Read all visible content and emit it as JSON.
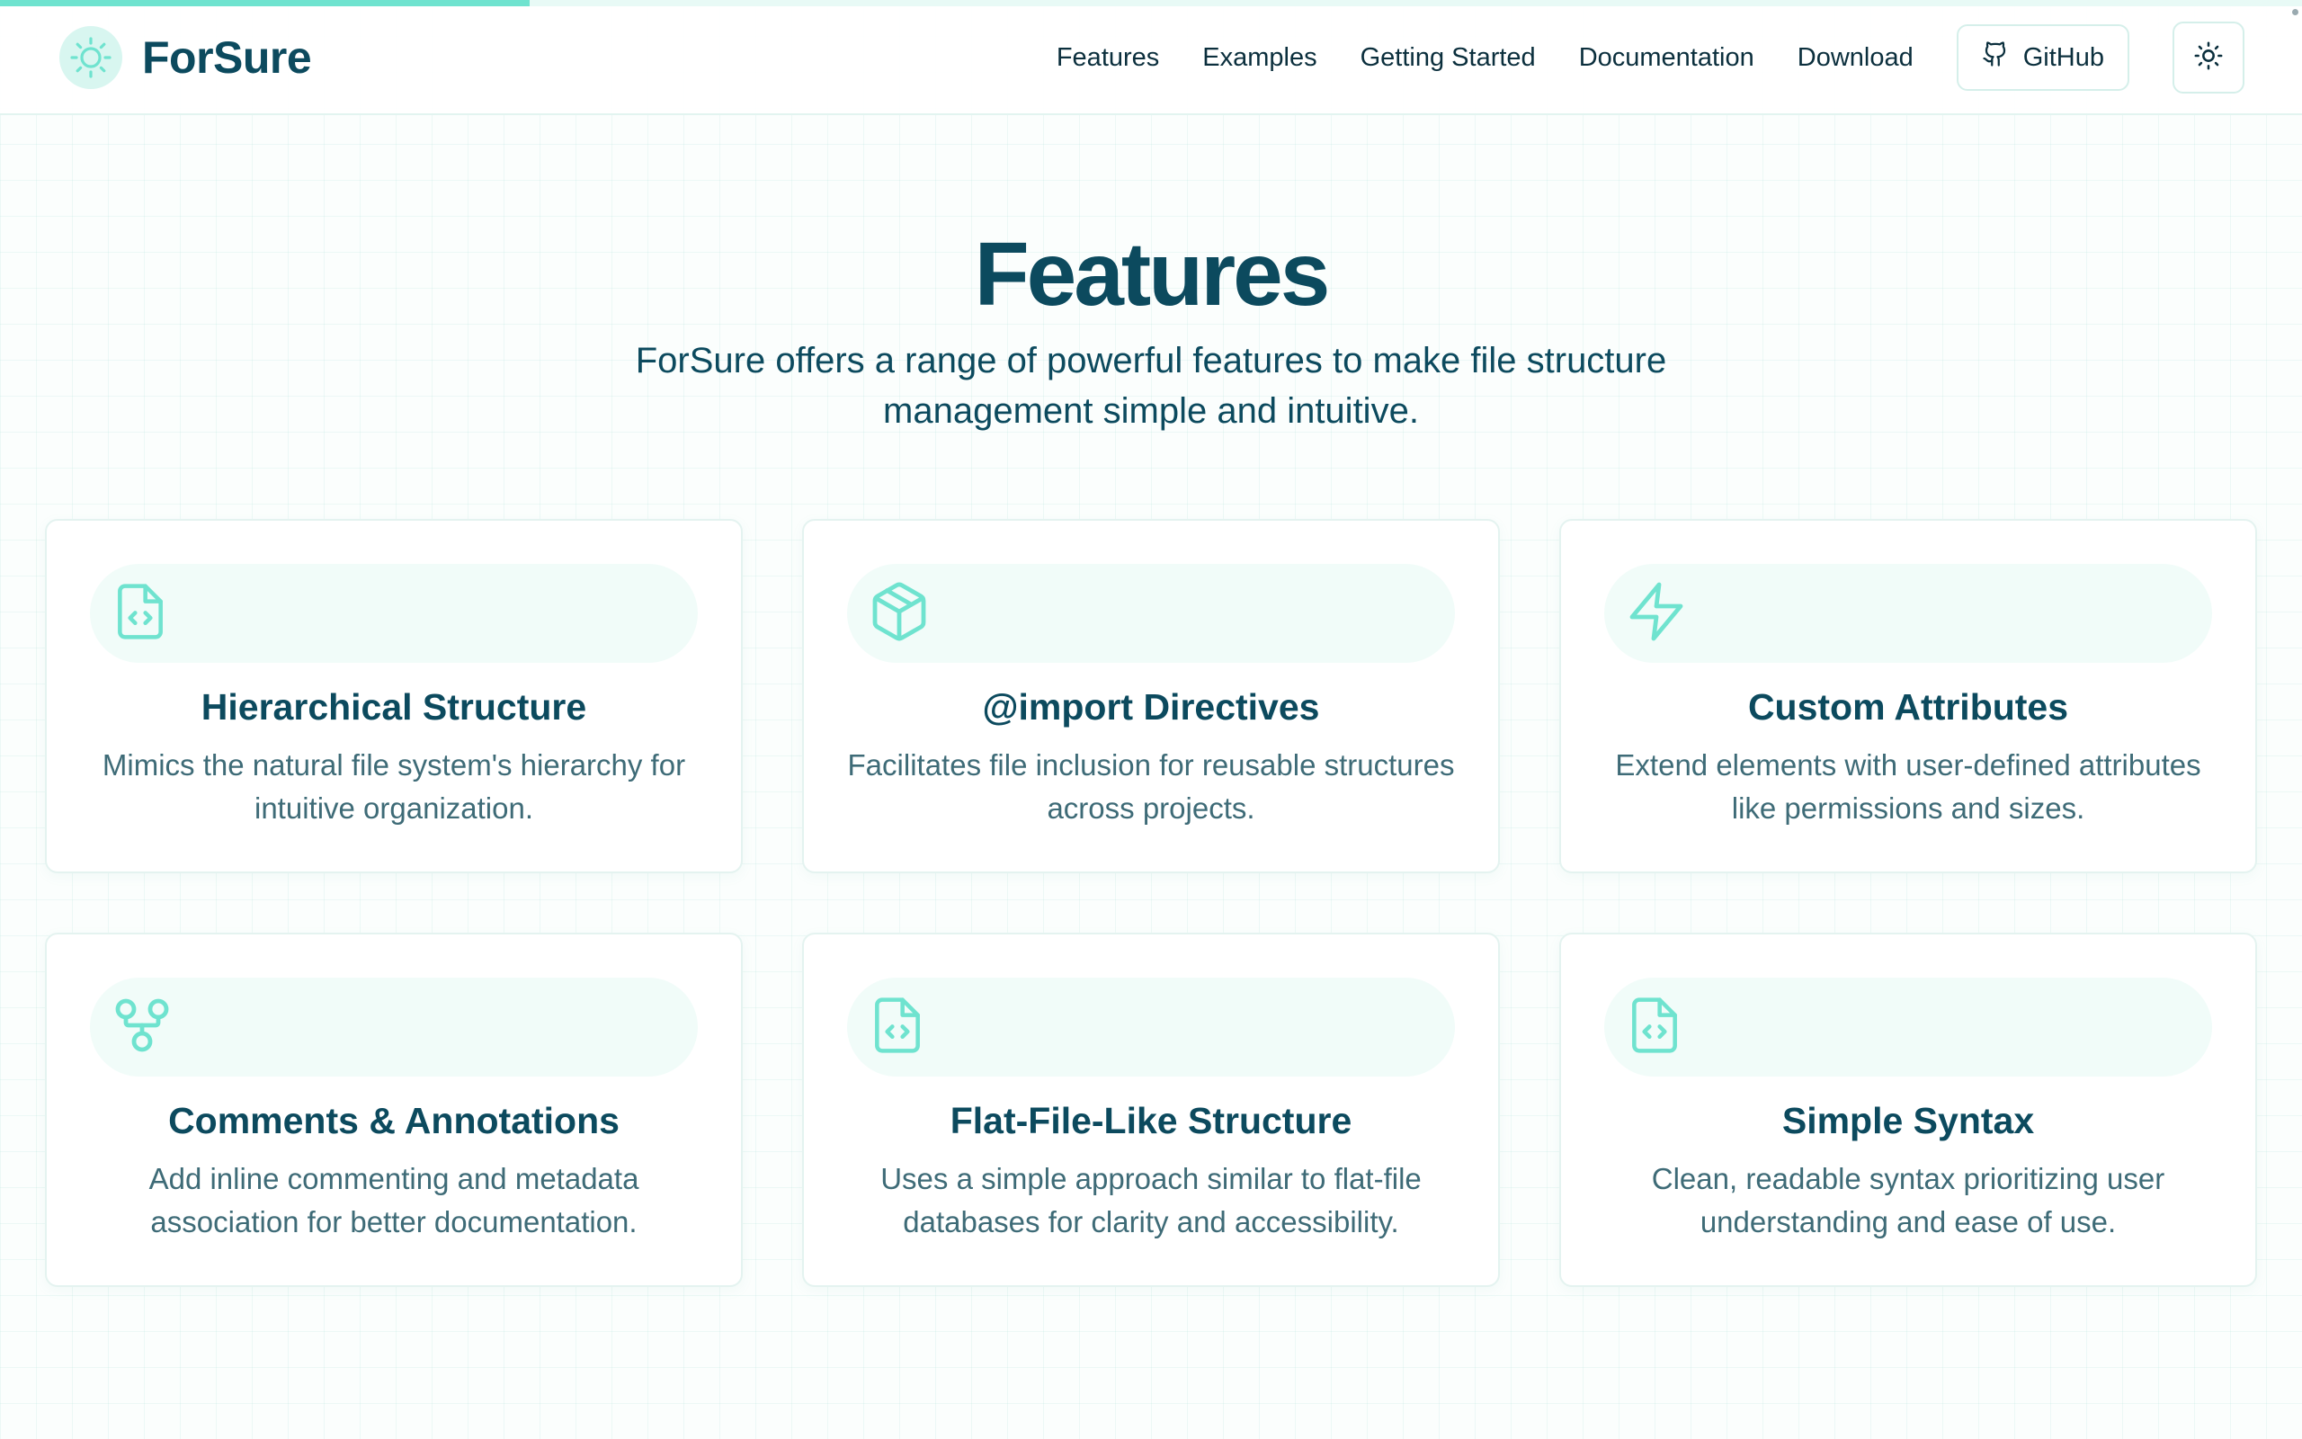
{
  "page_progress": 0.23,
  "brand": {
    "name": "ForSure",
    "logo_icon": "sun-logo-icon"
  },
  "nav": {
    "links": [
      "Features",
      "Examples",
      "Getting Started",
      "Documentation",
      "Download"
    ],
    "github_label": "GitHub",
    "github_icon": "github-icon",
    "theme_icon": "sun-icon"
  },
  "hero": {
    "title": "Features",
    "subtitle": "ForSure offers a range of powerful features to make file structure management simple and intuitive."
  },
  "features": [
    {
      "icon": "file-code-icon",
      "title": "Hierarchical Structure",
      "description": "Mimics the natural file system's hierarchy for intuitive organization."
    },
    {
      "icon": "package-icon",
      "title": "@import Directives",
      "description": "Facilitates file inclusion for reusable structures across projects."
    },
    {
      "icon": "lightning-icon",
      "title": "Custom Attributes",
      "description": "Extend elements with user-defined attributes like permissions and sizes."
    },
    {
      "icon": "git-fork-icon",
      "title": "Comments & Annotations",
      "description": "Add inline commenting and metadata association for better documentation."
    },
    {
      "icon": "file-code-icon",
      "title": "Flat-File-Like Structure",
      "description": "Uses a simple approach similar to flat-file databases for clarity and accessibility."
    },
    {
      "icon": "file-code-icon",
      "title": "Simple Syntax",
      "description": "Clean, readable syntax prioritizing user understanding and ease of use."
    }
  ],
  "colors": {
    "accent": "#6fe3cf",
    "heading": "#0c4a5e",
    "text": "#3e6b77"
  }
}
